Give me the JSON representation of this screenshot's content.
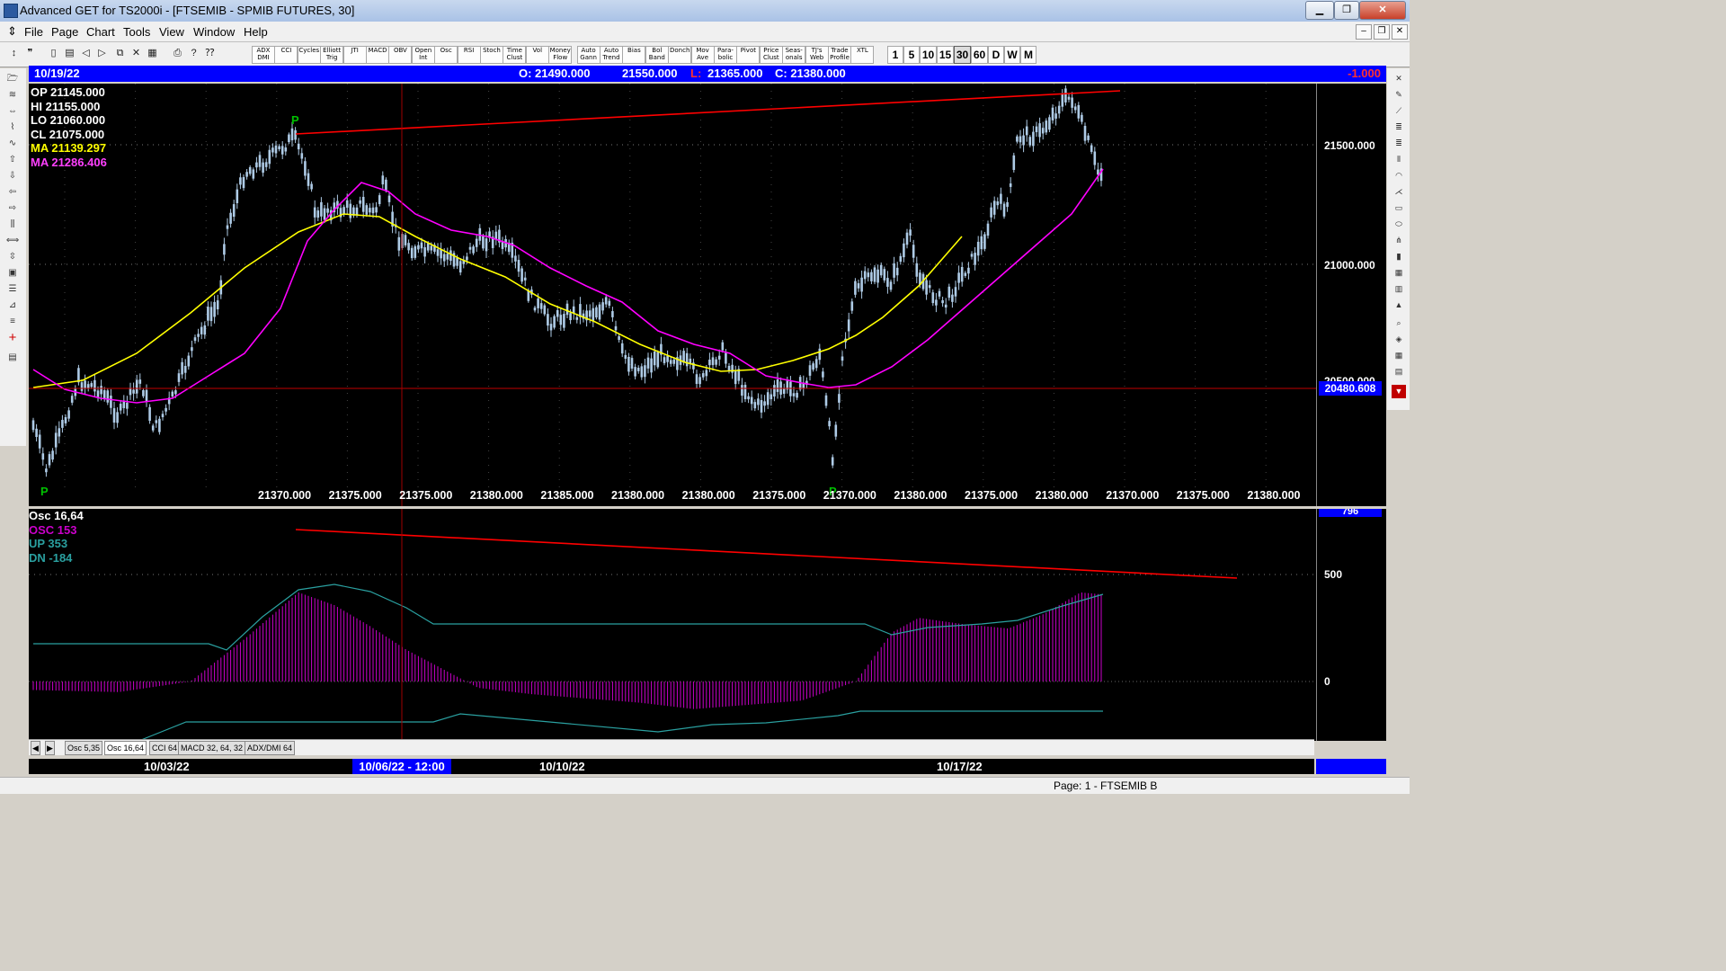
{
  "window": {
    "title": "Advanced GET for TS2000i - [FTSEMIB - SPMIB FUTURES, 30]",
    "minimize": "▁",
    "restore": "❐",
    "close": "✕",
    "mdi_min": "–",
    "mdi_restore": "❐",
    "mdi_close": "✕"
  },
  "menu": [
    "File",
    "Page",
    "Chart",
    "Tools",
    "View",
    "Window",
    "Help"
  ],
  "toolbar": {
    "indicators": [
      "ADX DMI",
      "CCI",
      "Cycles",
      "Elliott Trig",
      "JTI",
      "MACD",
      "OBV",
      "Open Int",
      "Osc",
      "RSI",
      "Stoch",
      "Time Clust",
      "Vol",
      "Money Flow",
      "Auto Gann",
      "Auto Trend",
      "Bias",
      "Bol Band",
      "Donch",
      "Mov Ave",
      "Para-bolic",
      "Pivot",
      "Price Clust",
      "Seas-onals",
      "TJ's Web",
      "Trade Profile",
      "XTL"
    ],
    "timeframes": [
      "1",
      "5",
      "10",
      "15",
      "30",
      "60",
      "D",
      "W",
      "M"
    ]
  },
  "infobar": {
    "date": "10/19/22",
    "open": "O: 21490.000",
    "high": "21550.000",
    "low_tag": "L:",
    "low": "21365.000",
    "close": "C: 21380.000",
    "change": "-1.000"
  },
  "price_legend": {
    "op": "OP  21145.000",
    "hi": "HI   21155.000",
    "lo": "LO  21060.000",
    "cl": "CL  21075.000",
    "ma1": "MA  21139.297",
    "ma2": "MA  21286.406"
  },
  "price_scale": {
    "upper": "21500.000",
    "middle": "21000.000",
    "partial": "20500.000",
    "cursor": "20480.608"
  },
  "pivots": [
    "P",
    "P",
    "P"
  ],
  "bottom_price_labels": [
    "21370.000",
    "21375.000",
    "21375.000",
    "21380.000",
    "21385.000",
    "21380.000",
    "21380.000",
    "21375.000",
    "21370.000",
    "21380.000",
    "21375.000",
    "21380.000",
    "21370.000",
    "21375.000",
    "21380.000"
  ],
  "osc_legend": {
    "title": "Osc 16,64",
    "osc": "OSC 153",
    "up": "UP   353",
    "dn": "DN   -184"
  },
  "osc_scale": {
    "top": "796",
    "mid": "500",
    "zero": "0"
  },
  "osc_tabs": [
    "Osc 5,35",
    "Osc 16,64",
    "CCI 64",
    "MACD 32, 64, 32",
    "ADX/DMI 64"
  ],
  "osc_nav": {
    "prev": "◀",
    "next": "▶"
  },
  "dates": [
    "10/03/22",
    "10/06/22 - 12:00",
    "10/10/22",
    "10/17/22"
  ],
  "status": "Page: 1 - FTSEMIB B",
  "colors": {
    "candle": "#aecbe6",
    "ma_fast": "#ffff00",
    "ma_slow": "#ff00ff",
    "trendline": "#ff0000",
    "osc_hist": "#cc00cc",
    "osc_band": "#2aa0a0",
    "pivot": "#00c000"
  }
}
